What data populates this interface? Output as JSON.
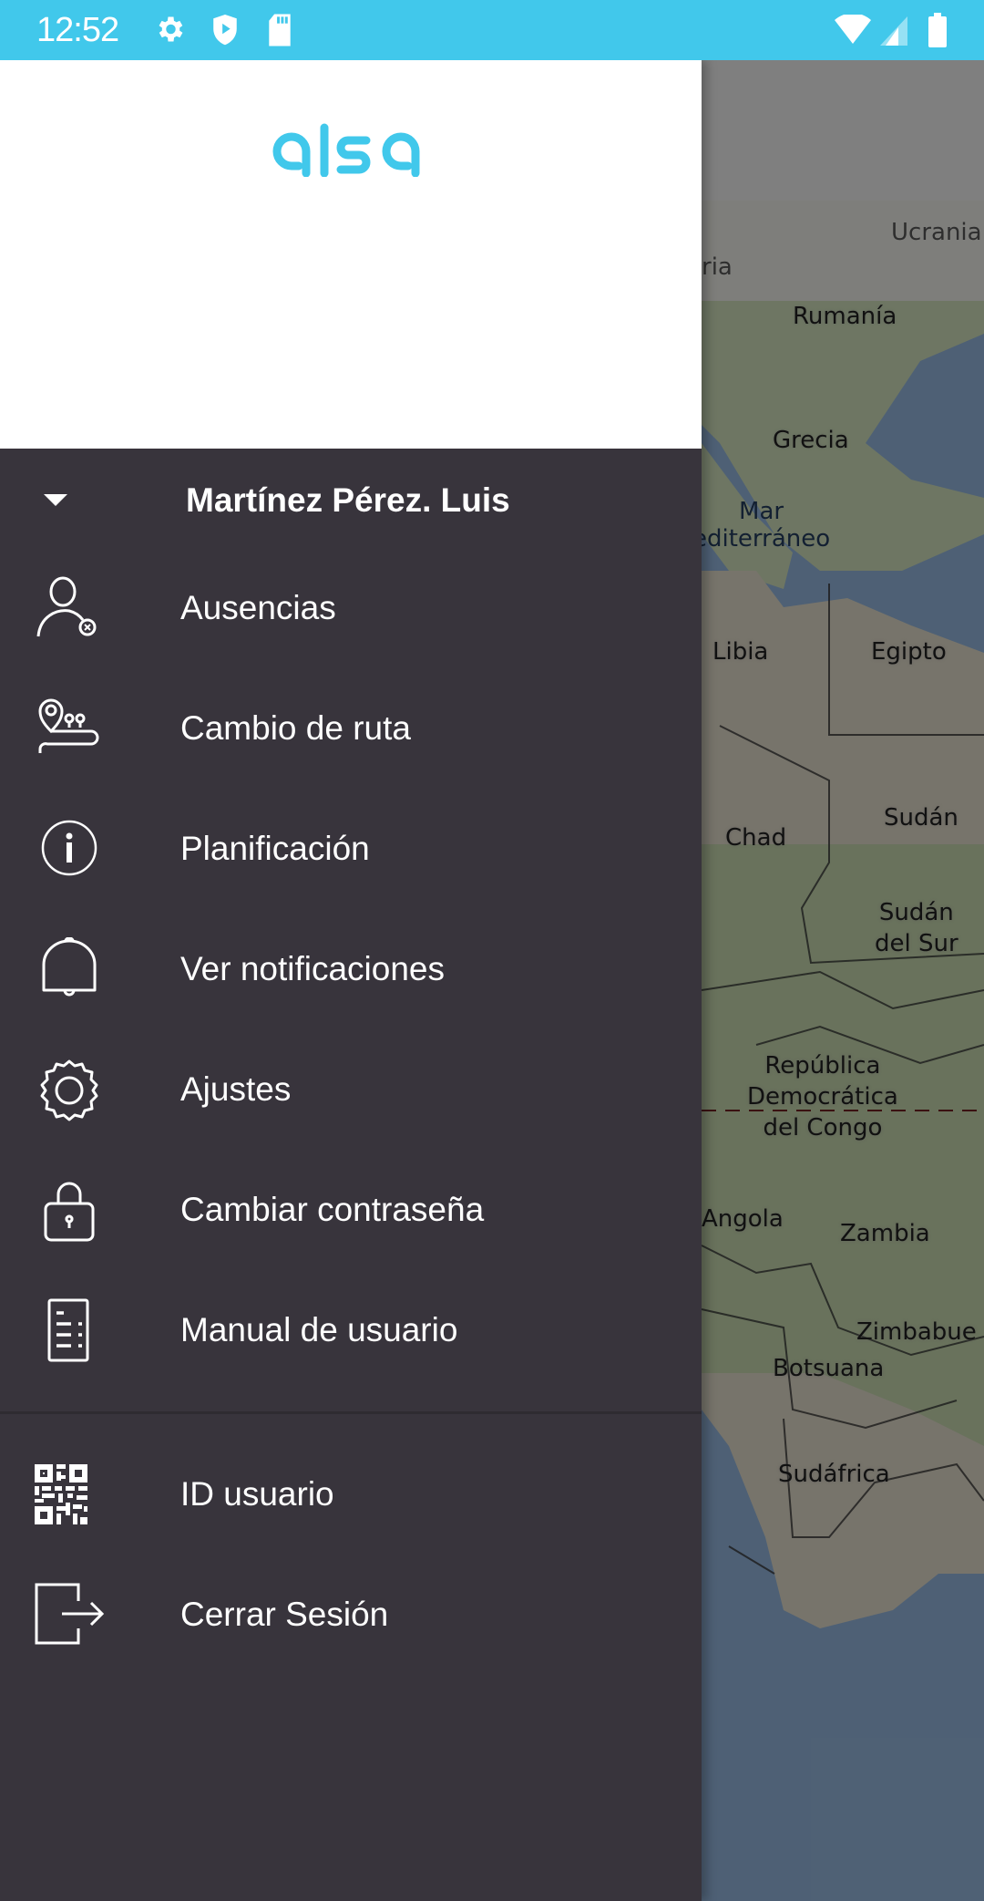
{
  "status_bar": {
    "time": "12:52",
    "left_icons": [
      "gear-icon",
      "shield-play-icon",
      "sd-card-icon"
    ],
    "right_icons": [
      "wifi-icon",
      "cell-signal-icon",
      "battery-icon"
    ],
    "background_color": "#41c8eb"
  },
  "drawer": {
    "logo_text": "alsa",
    "logo_color": "#41c8eb",
    "background_color": "#38343c",
    "account": {
      "name": "Martínez Pérez. Luis"
    },
    "primary_items": [
      {
        "label": "Ausencias",
        "icon": "user-absence-icon"
      },
      {
        "label": "Cambio de ruta",
        "icon": "route-change-icon"
      },
      {
        "label": "Planificación",
        "icon": "info-icon"
      },
      {
        "label": "Ver notificaciones",
        "icon": "bell-icon"
      },
      {
        "label": "Ajustes",
        "icon": "settings-gear-icon"
      },
      {
        "label": "Cambiar contraseña",
        "icon": "lock-icon"
      },
      {
        "label": "Manual de usuario",
        "icon": "document-icon"
      }
    ],
    "secondary_items": [
      {
        "label": "ID usuario",
        "icon": "qr-code-icon"
      },
      {
        "label": "Cerrar Sesión",
        "icon": "logout-icon"
      }
    ]
  },
  "map": {
    "labels": [
      {
        "text": "Ucrania",
        "kind": "faded"
      },
      {
        "text": "ria",
        "kind": "faded"
      },
      {
        "text": "Rumanía",
        "kind": "country"
      },
      {
        "text": "Grecia",
        "kind": "country"
      },
      {
        "text": "Mar\nediterráneo",
        "kind": "water"
      },
      {
        "text": "Libia",
        "kind": "country"
      },
      {
        "text": "Egipto",
        "kind": "country"
      },
      {
        "text": "Chad",
        "kind": "country"
      },
      {
        "text": "Sudán",
        "kind": "country"
      },
      {
        "text": "Sudán\ndel Sur",
        "kind": "country"
      },
      {
        "text": "República\nDemocrática\ndel Congo",
        "kind": "country"
      },
      {
        "text": "Angola",
        "kind": "country"
      },
      {
        "text": "Zambia",
        "kind": "country"
      },
      {
        "text": "Zimbabue",
        "kind": "country"
      },
      {
        "text": "Botsuana",
        "kind": "country"
      },
      {
        "text": "Sudáfrica",
        "kind": "country"
      }
    ]
  }
}
